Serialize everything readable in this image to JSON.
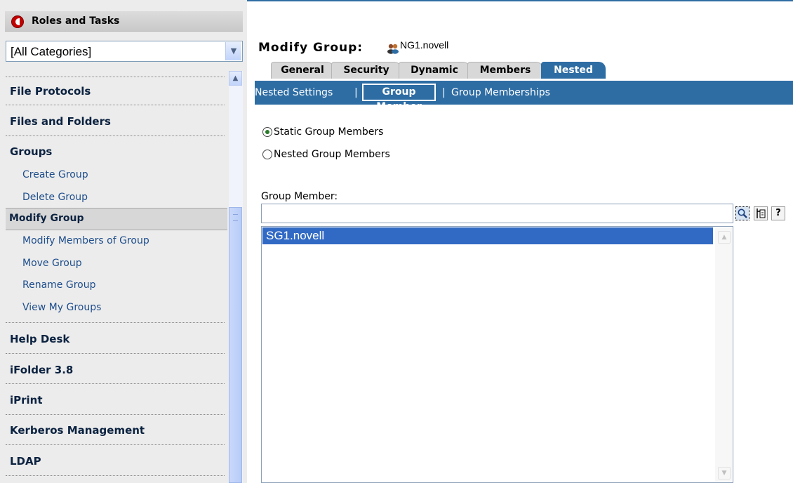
{
  "sidebar": {
    "header_title": "Roles and Tasks",
    "category_select": "[All Categories]",
    "categories": {
      "file_protocols": "File Protocols",
      "files_and_folders": "Files and Folders",
      "groups": "Groups",
      "help_desk": "Help Desk",
      "ifolder": "iFolder 3.8",
      "iprint": "iPrint",
      "kerberos": "Kerberos Management",
      "ldap": "LDAP"
    },
    "group_tasks": {
      "create": "Create Group",
      "delete": "Delete Group",
      "modify": "Modify Group",
      "modify_members": "Modify Members of Group",
      "move": "Move Group",
      "rename": "Rename Group",
      "view_my": "View My Groups"
    },
    "selected_task": "Modify Group"
  },
  "main": {
    "title": "Modify Group:",
    "object_name": "NG1.novell",
    "tabs": [
      "General",
      "Security",
      "Dynamic",
      "Members",
      "Nested"
    ],
    "active_tab": "Nested",
    "subtabs": {
      "nested_settings": "Nested Settings",
      "group_member": "Group Member",
      "group_memberships": "Group Memberships",
      "separator": "|"
    },
    "active_subtab": "Group Member",
    "radios": {
      "static": "Static Group Members",
      "nested": "Nested Group Members",
      "selected": "static"
    },
    "group_member_label": "Group Member:",
    "group_member_value": "",
    "members": [
      "SG1.novell"
    ],
    "icons": [
      "search-icon",
      "object-browser-icon",
      "help-icon"
    ],
    "colors": {
      "accent": "#2e6da4",
      "selection": "#316ac5"
    }
  }
}
